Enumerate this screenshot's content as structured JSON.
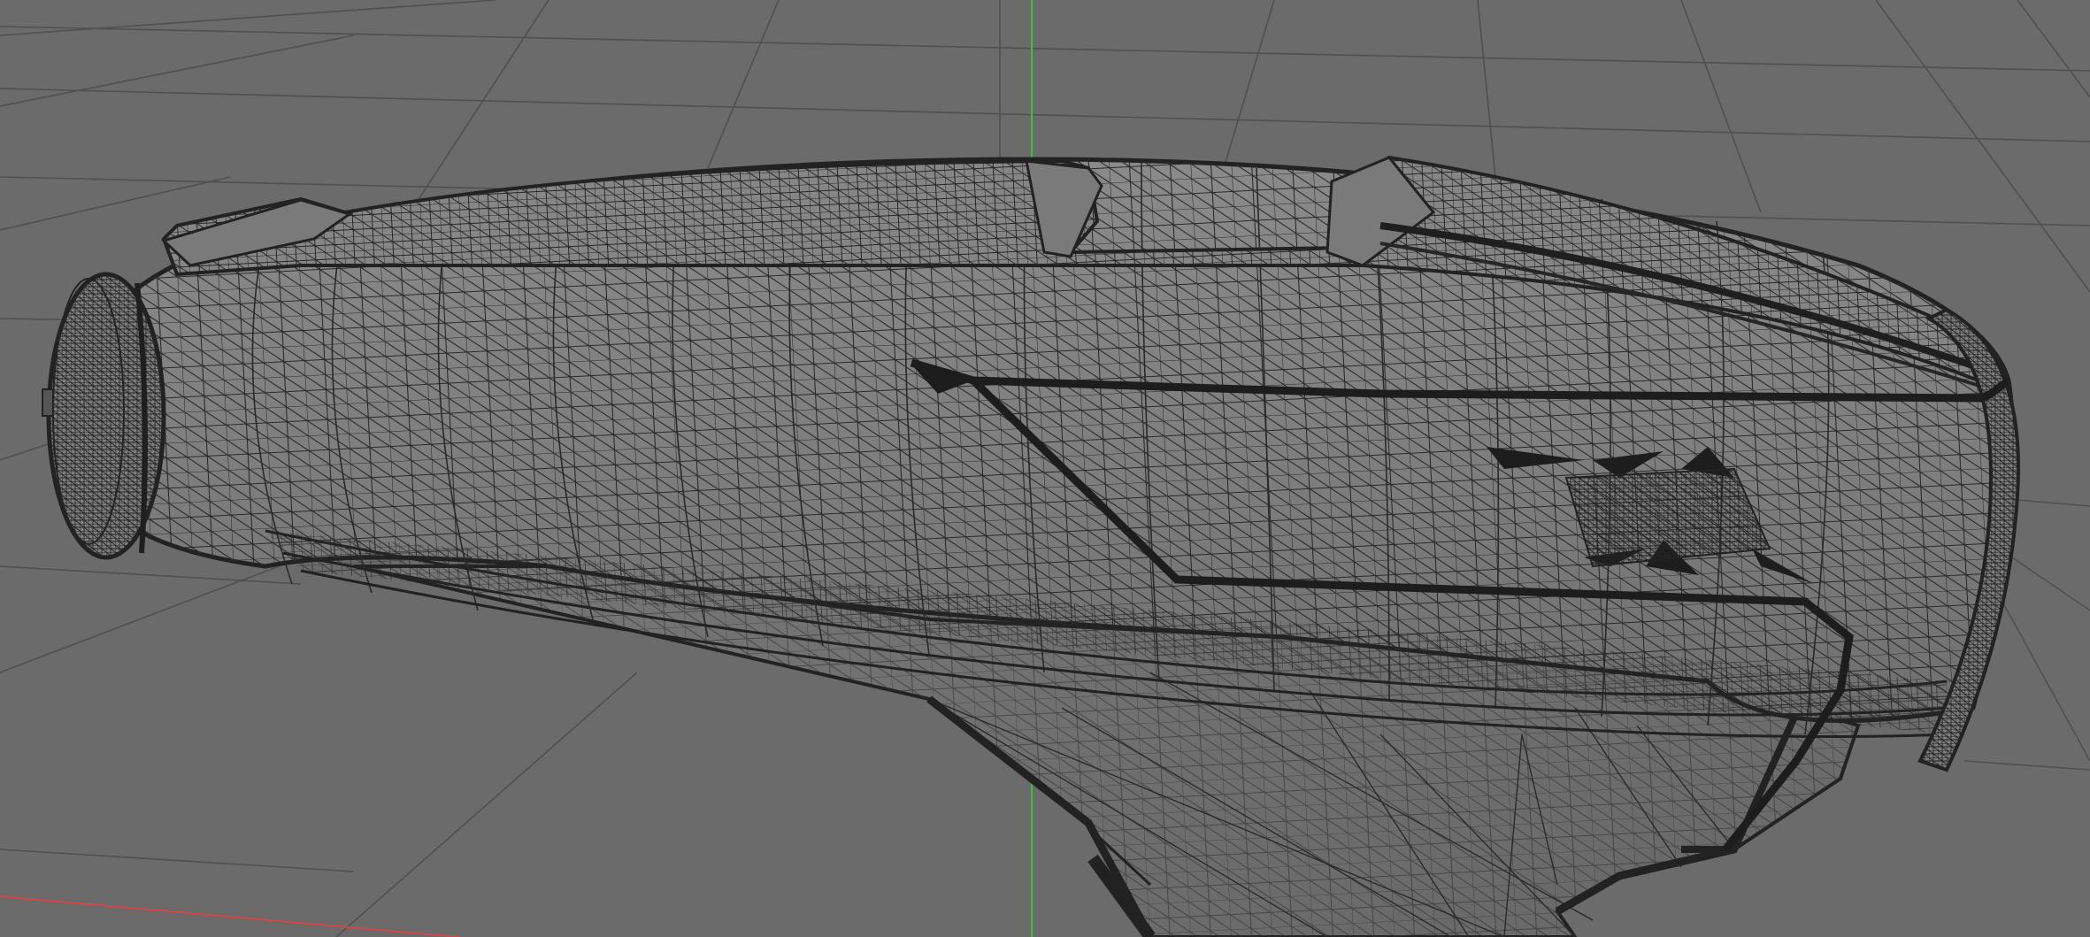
{
  "viewport": {
    "mode": "wireframe-on-shaded",
    "colors": {
      "background": "#6b6b6b",
      "grid_line": "#505050",
      "mesh_fill_light": "#858585",
      "mesh_fill_mid": "#777777",
      "mesh_fill_dark": "#666666",
      "wire": "#2a2a2a",
      "axis_x": "#d04848",
      "axis_y": "#3fbf3f"
    },
    "icons": [
      "perspective-grid",
      "world-axis-x",
      "world-axis-y"
    ],
    "model": {
      "name": "",
      "shape": "hair-dryer-body",
      "display": "triangulated-wireframe"
    }
  }
}
